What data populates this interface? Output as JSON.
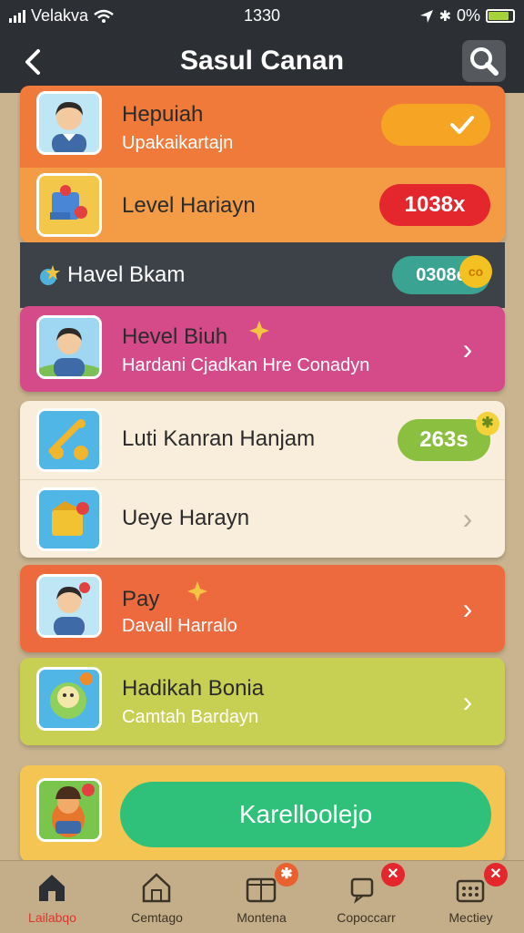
{
  "status_bar": {
    "carrier": "Velakva",
    "time": "1330",
    "battery": "0%"
  },
  "header": {
    "title": "Sasul Canan",
    "back_icon": "chevron-left-icon",
    "search_icon": "search-icon"
  },
  "items": [
    {
      "title": "Hepuiah",
      "subtitle": "Upakaikartajn",
      "color": "#ef7a3a",
      "toggle_on": true
    },
    {
      "title": "Level Hariayn",
      "badge": "1038x",
      "color": "#f49c45",
      "badge_color": "#e3272c"
    },
    {
      "title": "Havel Bkam",
      "badge": "0308e",
      "color": "#3d4248",
      "badge_color": "#3aa391"
    },
    {
      "title": "Hevel Biuh",
      "subtitle": "Hardani Cjadkan Hre Conadyn",
      "color": "#d54b8a"
    },
    {
      "title": "Luti Kanran Hanjam",
      "badge": "263s",
      "color": "#f8eedb",
      "badge_color": "#8bbf3f"
    },
    {
      "title": "Ueye Harayn",
      "color": "#f8eedb"
    },
    {
      "title": "Pay",
      "subtitle": "Davall Harralo",
      "color": "#ec6a3e"
    },
    {
      "title": "Hadikah Bonia",
      "subtitle": "Camtah Bardayn",
      "color": "#c7d052"
    }
  ],
  "cta": {
    "label": "Karelloolejo",
    "color": "#2fc07a"
  },
  "tabs": [
    {
      "label": "Lailabqo",
      "icon": "home-icon",
      "active": true
    },
    {
      "label": "Cemtago",
      "icon": "house-outline-icon"
    },
    {
      "label": "Montena",
      "icon": "wallet-icon",
      "badge": "✱"
    },
    {
      "label": "Copoccarr",
      "icon": "chat-icon",
      "badge": "✕"
    },
    {
      "label": "Mectiey",
      "icon": "grid-icon",
      "badge": "✕"
    }
  ]
}
